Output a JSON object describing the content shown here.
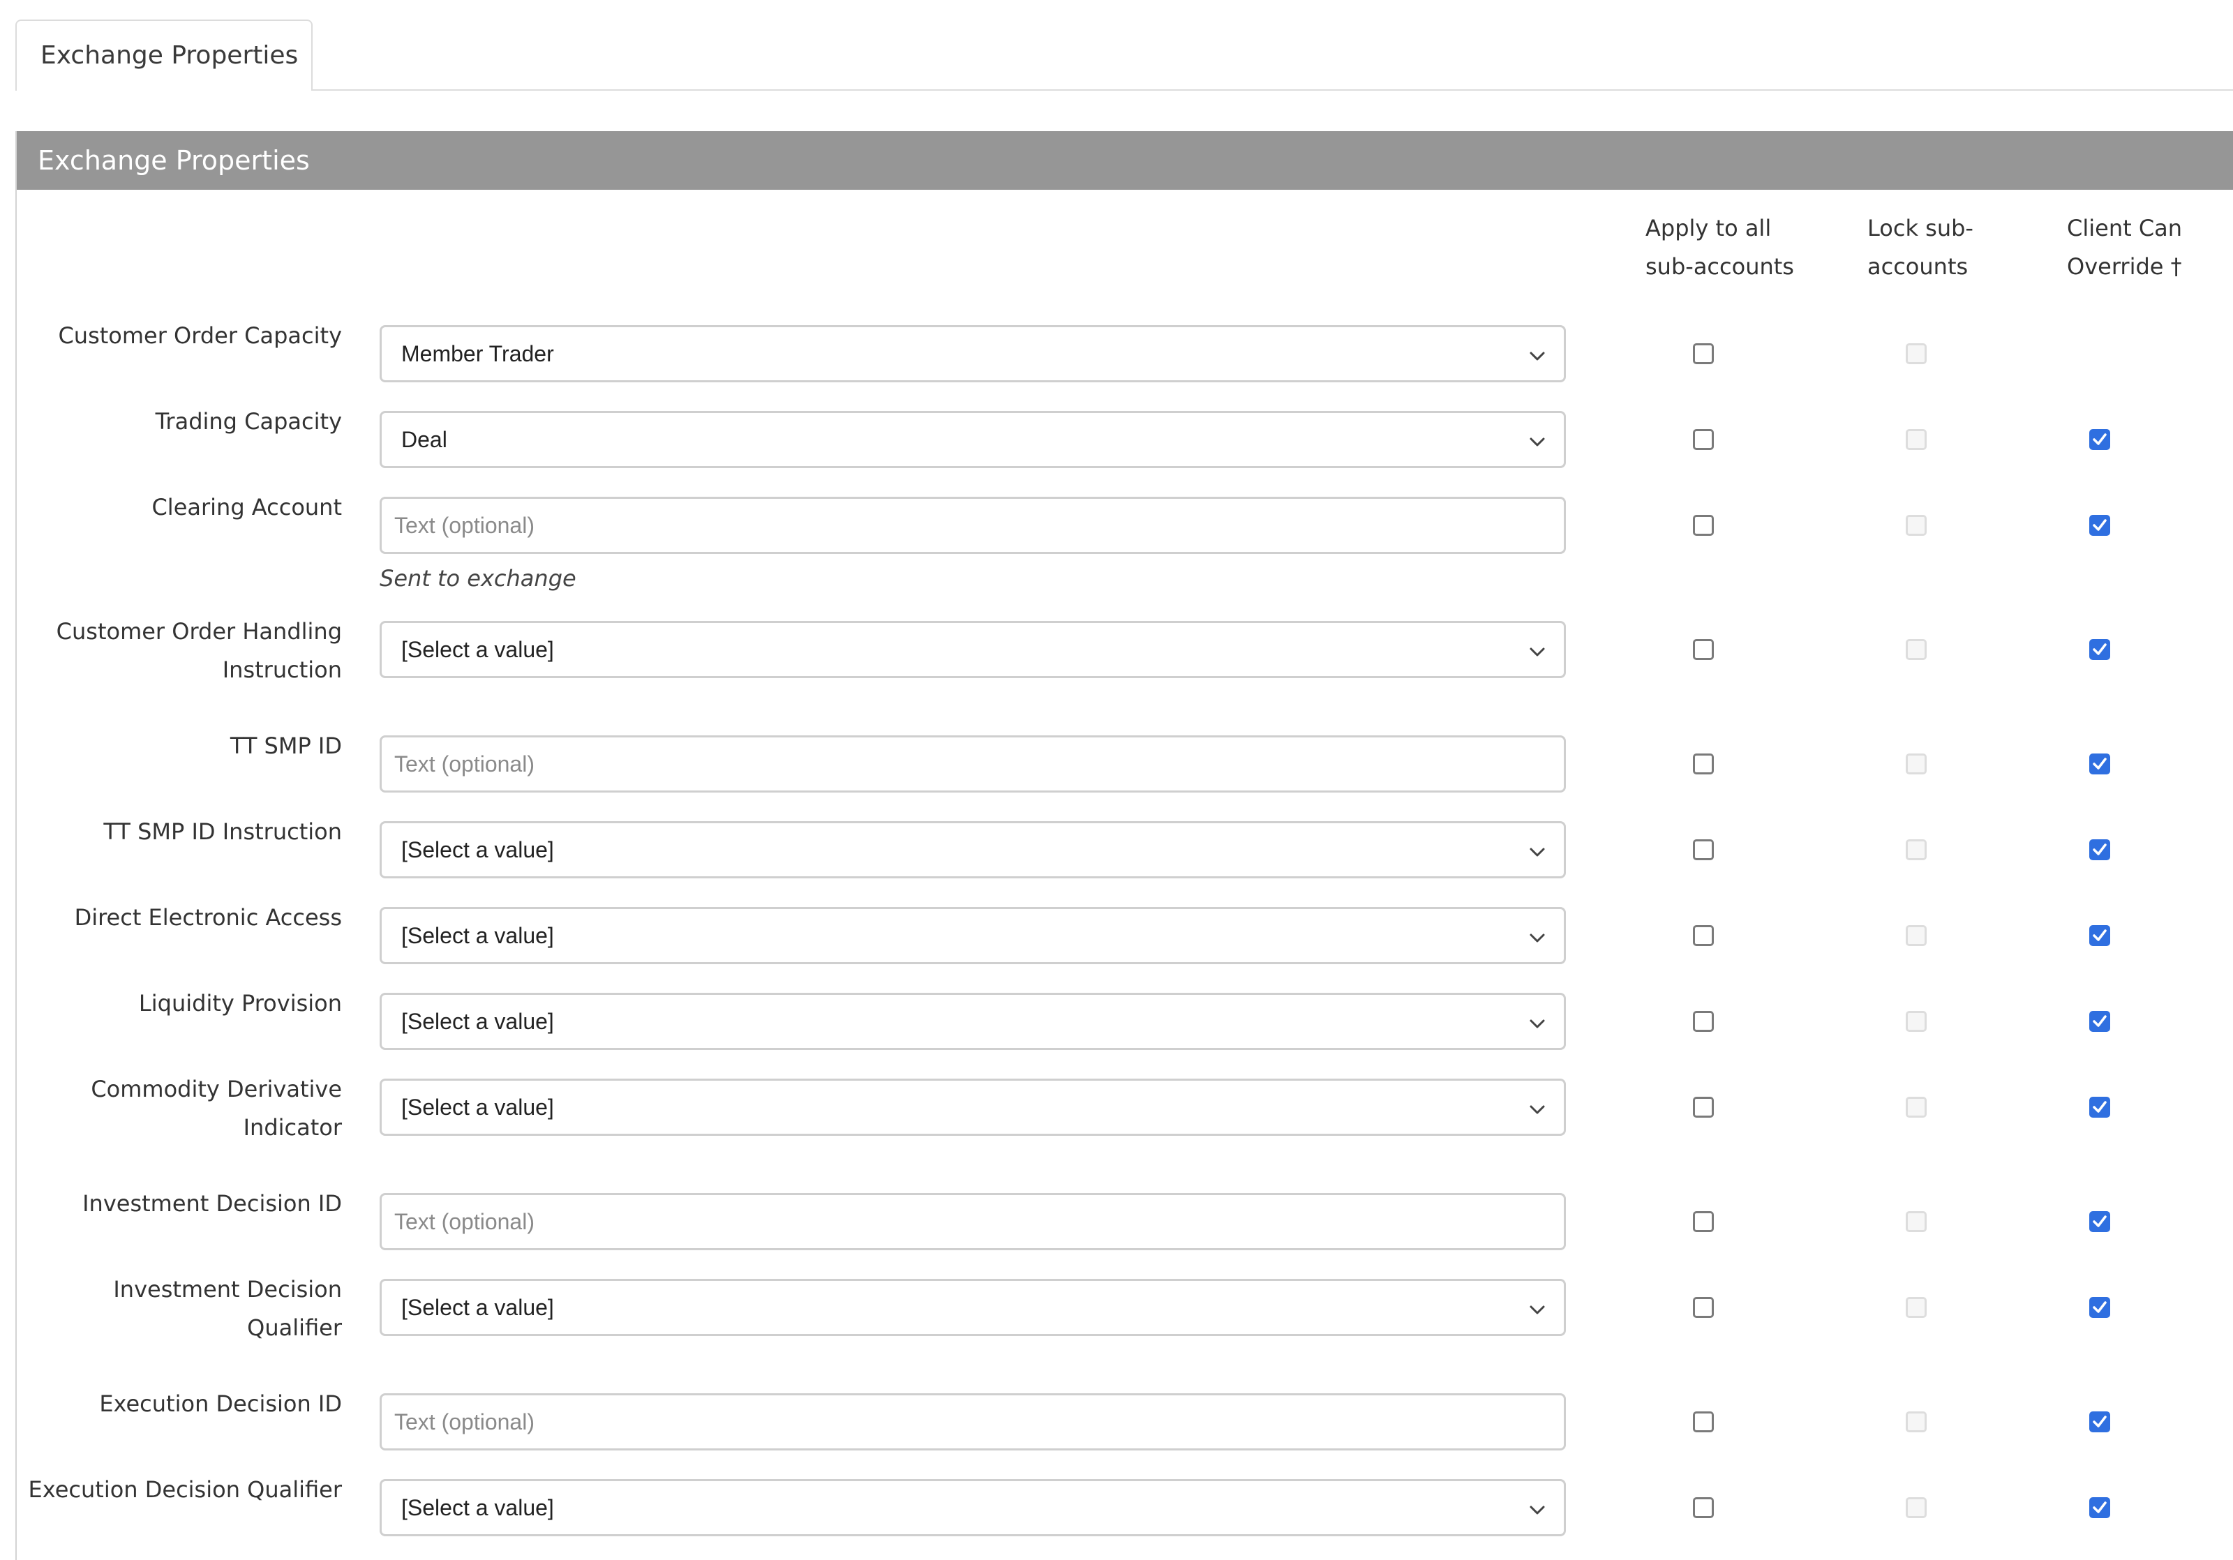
{
  "tab": {
    "label": "Exchange Properties"
  },
  "panel": {
    "title": "Exchange Properties"
  },
  "columns": {
    "apply": [
      "Apply to all",
      "sub-accounts"
    ],
    "lock": [
      "Lock sub-",
      "accounts"
    ],
    "client": [
      "Client Can",
      "Override †"
    ]
  },
  "rows": [
    {
      "label": [
        "Customer Order Capacity"
      ],
      "type": "select",
      "value": "Member Trader",
      "apply": false,
      "client": null
    },
    {
      "label": [
        "Trading Capacity"
      ],
      "type": "select",
      "value": "Deal",
      "apply": false,
      "client": true
    },
    {
      "label": [
        "Clearing Account"
      ],
      "type": "text",
      "placeholder": "Text (optional)",
      "hint": "Sent to exchange",
      "apply": false,
      "client": true
    },
    {
      "label": [
        "Customer Order Handling",
        "Instruction"
      ],
      "type": "select",
      "value": "[Select a value]",
      "apply": false,
      "client": true
    },
    {
      "label": [
        "TT SMP ID"
      ],
      "type": "text",
      "placeholder": "Text (optional)",
      "apply": false,
      "client": true
    },
    {
      "label": [
        "TT SMP ID Instruction"
      ],
      "type": "select",
      "value": "[Select a value]",
      "apply": false,
      "client": true
    },
    {
      "label": [
        "Direct Electronic Access"
      ],
      "type": "select",
      "value": "[Select a value]",
      "apply": false,
      "client": true
    },
    {
      "label": [
        "Liquidity Provision"
      ],
      "type": "select",
      "value": "[Select a value]",
      "apply": false,
      "client": true
    },
    {
      "label": [
        "Commodity Derivative",
        "Indicator"
      ],
      "type": "select",
      "value": "[Select a value]",
      "apply": false,
      "client": true
    },
    {
      "label": [
        "Investment Decision ID"
      ],
      "type": "text",
      "placeholder": "Text (optional)",
      "apply": false,
      "client": true
    },
    {
      "label": [
        "Investment Decision",
        "Qualifier"
      ],
      "type": "select",
      "value": "[Select a value]",
      "apply": false,
      "client": true
    },
    {
      "label": [
        "Execution Decision ID"
      ],
      "type": "text",
      "placeholder": "Text (optional)",
      "apply": false,
      "client": true
    },
    {
      "label": [
        "Execution Decision Qualifier"
      ],
      "type": "select",
      "value": "[Select a value]",
      "apply": false,
      "client": true
    }
  ],
  "colors": {
    "header_bg": "#969696",
    "checkbox_checked": "#2f6fe0"
  },
  "icons": {
    "select_arrow": "chevron-down-icon",
    "checked": "checkmark-icon"
  }
}
